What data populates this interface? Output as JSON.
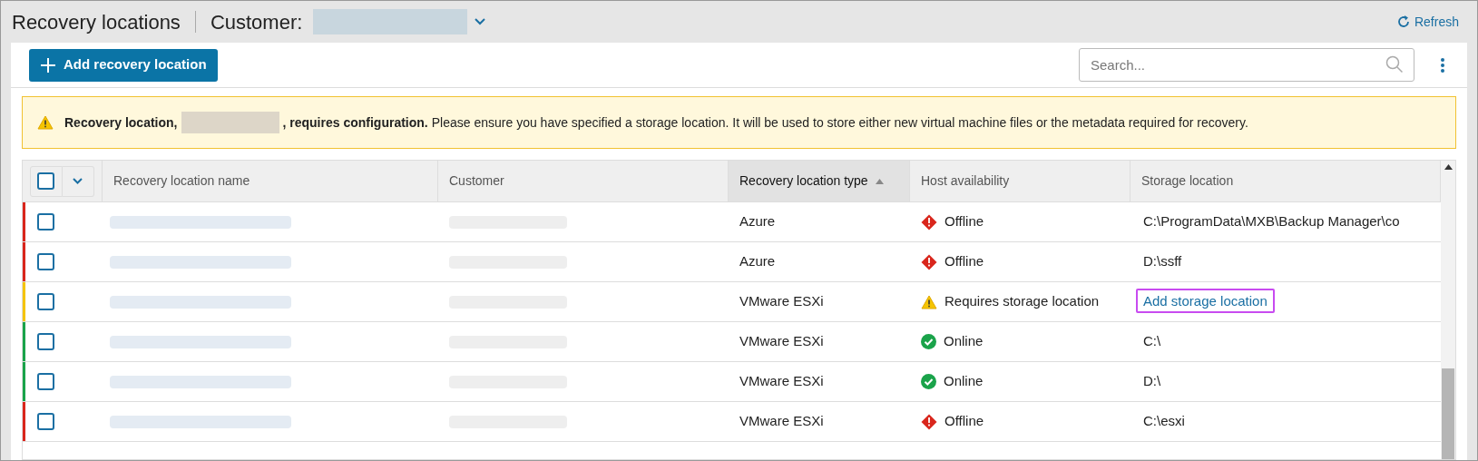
{
  "header": {
    "title": "Recovery locations",
    "customer_label": "Customer:",
    "refresh": "Refresh"
  },
  "toolbar": {
    "add_button": "Add recovery location",
    "search": {
      "placeholder": "Search..."
    }
  },
  "banner": {
    "lead": "Recovery location,",
    "lead_end": ", requires configuration.",
    "message": "Please ensure you have specified a storage location. It will be used to store either new virtual machine files or the metadata required for recovery."
  },
  "table": {
    "select_all": {
      "checked": false
    },
    "columns": [
      {
        "label": "Recovery location name",
        "sorted": false
      },
      {
        "label": "Customer",
        "sorted": false
      },
      {
        "label": "Recovery location type",
        "sorted": true
      },
      {
        "label": "Host availability",
        "sorted": false
      },
      {
        "label": "Storage location",
        "sorted": false
      }
    ],
    "rows": [
      {
        "color": "#d9261c",
        "checked": false,
        "type": "Azure",
        "host": {
          "kind": "offline",
          "text": "Offline"
        },
        "storage": {
          "kind": "text",
          "text": "C:\\ProgramData\\MXB\\Backup Manager\\co"
        }
      },
      {
        "color": "#d9261c",
        "checked": false,
        "type": "Azure",
        "host": {
          "kind": "offline",
          "text": "Offline"
        },
        "storage": {
          "kind": "text",
          "text": "D:\\ssff"
        }
      },
      {
        "color": "#f5c400",
        "checked": false,
        "type": "VMware ESXi",
        "host": {
          "kind": "warning",
          "text": "Requires storage location"
        },
        "storage": {
          "kind": "link",
          "text": "Add storage location",
          "highlighted": true
        }
      },
      {
        "color": "#1aa34a",
        "checked": false,
        "type": "VMware ESXi",
        "host": {
          "kind": "online",
          "text": "Online"
        },
        "storage": {
          "kind": "text",
          "text": "C:\\"
        }
      },
      {
        "color": "#1aa34a",
        "checked": false,
        "type": "VMware ESXi",
        "host": {
          "kind": "online",
          "text": "Online"
        },
        "storage": {
          "kind": "text",
          "text": "D:\\"
        }
      },
      {
        "color": "#d9261c",
        "checked": false,
        "type": "VMware ESXi",
        "host": {
          "kind": "offline",
          "text": "Offline"
        },
        "storage": {
          "kind": "text",
          "text": "C:\\esxi"
        }
      }
    ]
  }
}
